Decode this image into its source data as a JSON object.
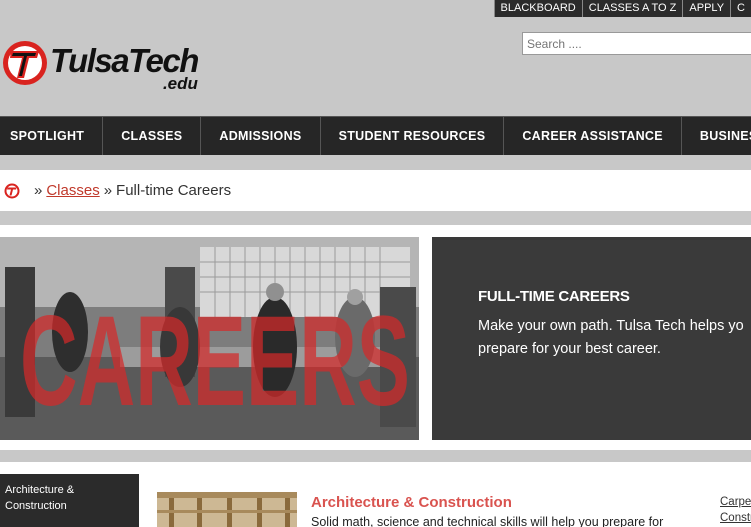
{
  "util_links": [
    "BLACKBOARD",
    "CLASSES A TO Z",
    "APPLY",
    "C"
  ],
  "search": {
    "placeholder": "Search ...."
  },
  "logo": {
    "name": "TulsaTech",
    "suffix": ".edu"
  },
  "nav": [
    "SPOTLIGHT",
    "CLASSES",
    "ADMISSIONS",
    "STUDENT RESOURCES",
    "CAREER ASSISTANCE",
    "BUSINESS & INDUSTRY"
  ],
  "breadcrumb": {
    "sep1": "»",
    "link": "Classes",
    "sep2": "»",
    "current": "Full-time Careers"
  },
  "hero": {
    "overlay_word": "CAREERS",
    "title": "FULL-TIME CAREERS",
    "text_line1": "Make your own path. Tulsa Tech helps yo",
    "text_line2": "prepare for your best career."
  },
  "category": {
    "sidebar_label_line1": "Architecture &",
    "sidebar_label_line2": "Construction",
    "title": "Architecture & Construction",
    "description": "Solid math, science and technical skills will help you prepare for",
    "links": [
      "Carpe",
      "Constr"
    ]
  },
  "colors": {
    "accent": "#c0392b",
    "dark": "#262626",
    "panel": "#3a3a3a"
  }
}
